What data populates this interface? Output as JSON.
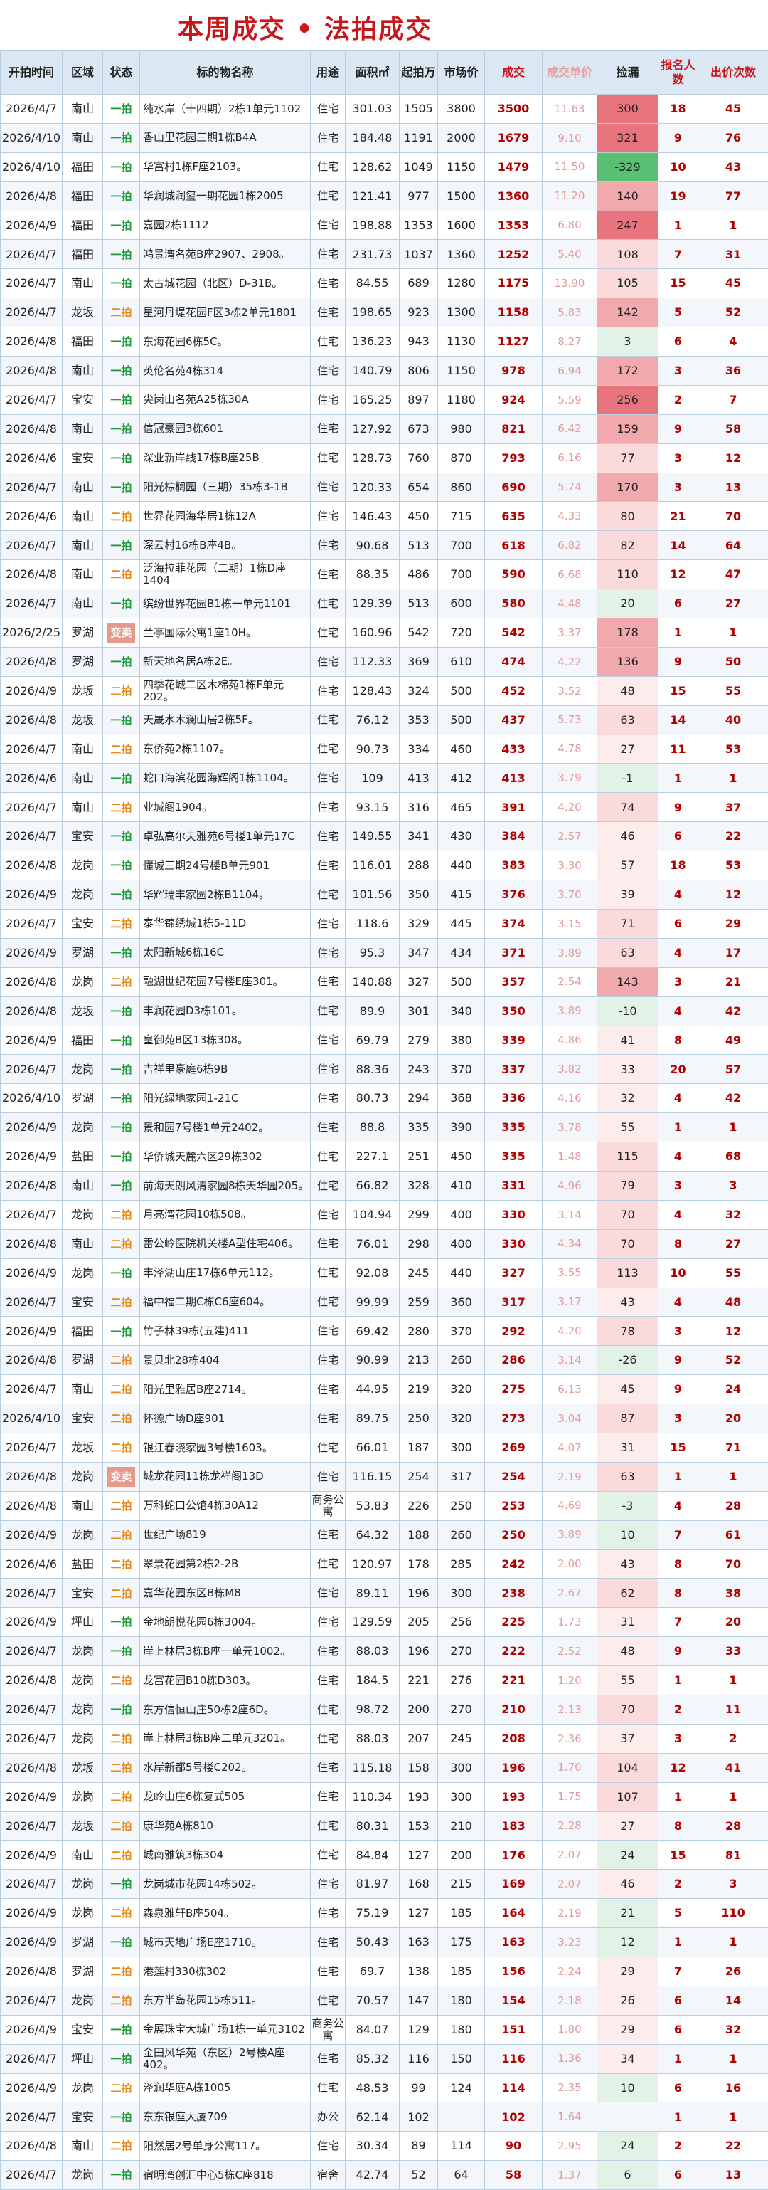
{
  "title": "本周成交 • 法拍成交",
  "headers": {
    "date": "开拍时间",
    "district": "区域",
    "status": "状态",
    "name": "标的物名称",
    "use": "用途",
    "area": "面积㎡",
    "start": "起拍万",
    "market": "市场价",
    "deal": "成交",
    "price": "成交单价",
    "gain": "捡漏",
    "bidders": "报名人数",
    "bids": "出价次数"
  },
  "rows": [
    [
      "2026/4/7",
      "南山",
      "一拍",
      "纯水岸（十四期）2栋1单元1102",
      "住宅",
      "301.03",
      "1505",
      "3800",
      "3500",
      "11.63",
      "300",
      "18",
      "45"
    ],
    [
      "2026/4/10",
      "南山",
      "一拍",
      "香山里花园三期1栋B4A",
      "住宅",
      "184.48",
      "1191",
      "2000",
      "1679",
      "9.10",
      "321",
      "9",
      "76"
    ],
    [
      "2026/4/10",
      "福田",
      "一拍",
      "华富村1栋F座2103。",
      "住宅",
      "128.62",
      "1049",
      "1150",
      "1479",
      "11.50",
      "-329",
      "10",
      "43"
    ],
    [
      "2026/4/8",
      "福田",
      "一拍",
      "华润城润玺一期花园1栋2005",
      "住宅",
      "121.41",
      "977",
      "1500",
      "1360",
      "11.20",
      "140",
      "19",
      "77"
    ],
    [
      "2026/4/9",
      "福田",
      "一拍",
      "嘉园2栋1112",
      "住宅",
      "198.88",
      "1353",
      "1600",
      "1353",
      "6.80",
      "247",
      "1",
      "1"
    ],
    [
      "2026/4/7",
      "福田",
      "一拍",
      "鸿景湾名苑B座2907、2908。",
      "住宅",
      "231.73",
      "1037",
      "1360",
      "1252",
      "5.40",
      "108",
      "7",
      "31"
    ],
    [
      "2026/4/7",
      "南山",
      "一拍",
      "太古城花园（北区）D-31B。",
      "住宅",
      "84.55",
      "689",
      "1280",
      "1175",
      "13.90",
      "105",
      "15",
      "45"
    ],
    [
      "2026/4/7",
      "龙坂",
      "二拍",
      "星河丹堤花园F区3栋2单元1801",
      "住宅",
      "198.65",
      "923",
      "1300",
      "1158",
      "5.83",
      "142",
      "5",
      "52"
    ],
    [
      "2026/4/8",
      "福田",
      "一拍",
      "东海花园6栋5C。",
      "住宅",
      "136.23",
      "943",
      "1130",
      "1127",
      "8.27",
      "3",
      "6",
      "4"
    ],
    [
      "2026/4/8",
      "南山",
      "一拍",
      "英伦名苑4栋314",
      "住宅",
      "140.79",
      "806",
      "1150",
      "978",
      "6.94",
      "172",
      "3",
      "36"
    ],
    [
      "2026/4/7",
      "宝安",
      "一拍",
      "尖岗山名苑A25栋30A",
      "住宅",
      "165.25",
      "897",
      "1180",
      "924",
      "5.59",
      "256",
      "2",
      "7"
    ],
    [
      "2026/4/8",
      "南山",
      "一拍",
      "信冠豪园3栋601",
      "住宅",
      "127.92",
      "673",
      "980",
      "821",
      "6.42",
      "159",
      "9",
      "58"
    ],
    [
      "2026/4/6",
      "宝安",
      "一拍",
      "深业新岸线17栋B座25B",
      "住宅",
      "128.73",
      "760",
      "870",
      "793",
      "6.16",
      "77",
      "3",
      "12"
    ],
    [
      "2026/4/7",
      "南山",
      "一拍",
      "阳光棕榈园（三期）35栋3-1B",
      "住宅",
      "120.33",
      "654",
      "860",
      "690",
      "5.74",
      "170",
      "3",
      "13"
    ],
    [
      "2026/4/6",
      "南山",
      "二拍",
      "世界花园海华居1栋12A",
      "住宅",
      "146.43",
      "450",
      "715",
      "635",
      "4.33",
      "80",
      "21",
      "70"
    ],
    [
      "2026/4/7",
      "南山",
      "一拍",
      "深云村16栋B座4B。",
      "住宅",
      "90.68",
      "513",
      "700",
      "618",
      "6.82",
      "82",
      "14",
      "64"
    ],
    [
      "2026/4/8",
      "南山",
      "二拍",
      "泛海拉菲花园（二期）1栋D座1404",
      "住宅",
      "88.35",
      "486",
      "700",
      "590",
      "6.68",
      "110",
      "12",
      "47"
    ],
    [
      "2026/4/7",
      "南山",
      "一拍",
      "缤纷世界花园B1栋一单元1101",
      "住宅",
      "129.39",
      "513",
      "600",
      "580",
      "4.48",
      "20",
      "6",
      "27"
    ],
    [
      "2026/2/25",
      "罗湖",
      "变卖",
      "兰亭国际公寓1座10H。",
      "住宅",
      "160.96",
      "542",
      "720",
      "542",
      "3.37",
      "178",
      "1",
      "1"
    ],
    [
      "2026/4/8",
      "罗湖",
      "一拍",
      "新天地名居A栋2E。",
      "住宅",
      "112.33",
      "369",
      "610",
      "474",
      "4.22",
      "136",
      "9",
      "50"
    ],
    [
      "2026/4/9",
      "龙坂",
      "二拍",
      "四季花城二区木棉苑1栋F单元202。",
      "住宅",
      "128.43",
      "324",
      "500",
      "452",
      "3.52",
      "48",
      "15",
      "55"
    ],
    [
      "2026/4/8",
      "龙坂",
      "一拍",
      "天晟水木澜山居2栋5F。",
      "住宅",
      "76.12",
      "353",
      "500",
      "437",
      "5.73",
      "63",
      "14",
      "40"
    ],
    [
      "2026/4/7",
      "南山",
      "二拍",
      "东侨苑2栋1107。",
      "住宅",
      "90.73",
      "334",
      "460",
      "433",
      "4.78",
      "27",
      "11",
      "53"
    ],
    [
      "2026/4/6",
      "南山",
      "一拍",
      "蛇口海滨花园海辉阁1栋1104。",
      "住宅",
      "109",
      "413",
      "412",
      "413",
      "3.79",
      "-1",
      "1",
      "1"
    ],
    [
      "2026/4/7",
      "南山",
      "二拍",
      "业城阁1904。",
      "住宅",
      "93.15",
      "316",
      "465",
      "391",
      "4.20",
      "74",
      "9",
      "37"
    ],
    [
      "2026/4/7",
      "宝安",
      "一拍",
      "卓弘高尔夫雅苑6号楼1单元17C",
      "住宅",
      "149.55",
      "341",
      "430",
      "384",
      "2.57",
      "46",
      "6",
      "22"
    ],
    [
      "2026/4/8",
      "龙岗",
      "一拍",
      "懂城三期24号楼B单元901",
      "住宅",
      "116.01",
      "288",
      "440",
      "383",
      "3.30",
      "57",
      "18",
      "53"
    ],
    [
      "2026/4/9",
      "龙岗",
      "一拍",
      "华辉瑞丰家园2栋B1104。",
      "住宅",
      "101.56",
      "350",
      "415",
      "376",
      "3.70",
      "39",
      "4",
      "12"
    ],
    [
      "2026/4/7",
      "宝安",
      "二拍",
      "泰华锦绣城1栋5-11D",
      "住宅",
      "118.6",
      "329",
      "445",
      "374",
      "3.15",
      "71",
      "6",
      "29"
    ],
    [
      "2026/4/9",
      "罗湖",
      "一拍",
      "太阳新城6栋16C",
      "住宅",
      "95.3",
      "347",
      "434",
      "371",
      "3.89",
      "63",
      "4",
      "17"
    ],
    [
      "2026/4/8",
      "龙岗",
      "二拍",
      "融湖世纪花园7号楼E座301。",
      "住宅",
      "140.88",
      "327",
      "500",
      "357",
      "2.54",
      "143",
      "3",
      "21"
    ],
    [
      "2026/4/8",
      "龙坂",
      "一拍",
      "丰润花园D3栋101。",
      "住宅",
      "89.9",
      "301",
      "340",
      "350",
      "3.89",
      "-10",
      "4",
      "42"
    ],
    [
      "2026/4/9",
      "福田",
      "一拍",
      "皇御苑B区13栋308。",
      "住宅",
      "69.79",
      "279",
      "380",
      "339",
      "4.86",
      "41",
      "8",
      "49"
    ],
    [
      "2026/4/7",
      "龙岗",
      "一拍",
      "吉祥里豪庭6栋9B",
      "住宅",
      "88.36",
      "243",
      "370",
      "337",
      "3.82",
      "33",
      "20",
      "57"
    ],
    [
      "2026/4/10",
      "罗湖",
      "一拍",
      "阳光绿地家园1-21C",
      "住宅",
      "80.73",
      "294",
      "368",
      "336",
      "4.16",
      "32",
      "4",
      "42"
    ],
    [
      "2026/4/9",
      "龙岗",
      "一拍",
      "景和园7号楼1单元2402。",
      "住宅",
      "88.8",
      "335",
      "390",
      "335",
      "3.78",
      "55",
      "1",
      "1"
    ],
    [
      "2026/4/9",
      "盐田",
      "一拍",
      "华侨城天麓六区29栋302",
      "住宅",
      "227.1",
      "251",
      "450",
      "335",
      "1.48",
      "115",
      "4",
      "68"
    ],
    [
      "2026/4/8",
      "南山",
      "一拍",
      "前海天朗风清家园8栋天华园205。",
      "住宅",
      "66.82",
      "328",
      "410",
      "331",
      "4.96",
      "79",
      "3",
      "3"
    ],
    [
      "2026/4/7",
      "龙岗",
      "二拍",
      "月亮湾花园10栋508。",
      "住宅",
      "104.94",
      "299",
      "400",
      "330",
      "3.14",
      "70",
      "4",
      "32"
    ],
    [
      "2026/4/8",
      "南山",
      "二拍",
      "雷公岭医院机关楼A型住宅406。",
      "住宅",
      "76.01",
      "298",
      "400",
      "330",
      "4.34",
      "70",
      "8",
      "27"
    ],
    [
      "2026/4/9",
      "龙岗",
      "一拍",
      "丰泽湖山庄17栋6单元112。",
      "住宅",
      "92.08",
      "245",
      "440",
      "327",
      "3.55",
      "113",
      "10",
      "55"
    ],
    [
      "2026/4/7",
      "宝安",
      "二拍",
      "福中福二期C栋C6座604。",
      "住宅",
      "99.99",
      "259",
      "360",
      "317",
      "3.17",
      "43",
      "4",
      "48"
    ],
    [
      "2026/4/9",
      "福田",
      "一拍",
      "竹子林39栋(五建)411",
      "住宅",
      "69.42",
      "280",
      "370",
      "292",
      "4.20",
      "78",
      "3",
      "12"
    ],
    [
      "2026/4/8",
      "罗湖",
      "二拍",
      "景贝北28栋404",
      "住宅",
      "90.99",
      "213",
      "260",
      "286",
      "3.14",
      "-26",
      "9",
      "52"
    ],
    [
      "2026/4/7",
      "南山",
      "二拍",
      "阳光里雅居B座2714。",
      "住宅",
      "44.95",
      "219",
      "320",
      "275",
      "6.13",
      "45",
      "9",
      "24"
    ],
    [
      "2026/4/10",
      "宝安",
      "二拍",
      "怀德广场D座901",
      "住宅",
      "89.75",
      "250",
      "320",
      "273",
      "3.04",
      "87",
      "3",
      "20"
    ],
    [
      "2026/4/7",
      "龙坂",
      "二拍",
      "银江春晓家园3号楼1603。",
      "住宅",
      "66.01",
      "187",
      "300",
      "269",
      "4.07",
      "31",
      "15",
      "71"
    ],
    [
      "2026/4/8",
      "龙岗",
      "变卖",
      "城龙花园11栋龙祥阁13D",
      "住宅",
      "116.15",
      "254",
      "317",
      "254",
      "2.19",
      "63",
      "1",
      "1"
    ],
    [
      "2026/4/8",
      "南山",
      "二拍",
      "万科蛇口公馆4栋30A12",
      "商务公寓",
      "53.83",
      "226",
      "250",
      "253",
      "4.69",
      "-3",
      "4",
      "28"
    ],
    [
      "2026/4/9",
      "龙岗",
      "二拍",
      "世纪广场819",
      "住宅",
      "64.32",
      "188",
      "260",
      "250",
      "3.89",
      "10",
      "7",
      "61"
    ],
    [
      "2026/4/6",
      "盐田",
      "二拍",
      "翠景花园第2栋2-2B",
      "住宅",
      "120.97",
      "178",
      "285",
      "242",
      "2.00",
      "43",
      "8",
      "70"
    ],
    [
      "2026/4/7",
      "宝安",
      "二拍",
      "嘉华花园东区B栋M8",
      "住宅",
      "89.11",
      "196",
      "300",
      "238",
      "2.67",
      "62",
      "8",
      "38"
    ],
    [
      "2026/4/9",
      "坪山",
      "一拍",
      "金地朗悦花园6栋3004。",
      "住宅",
      "129.59",
      "205",
      "256",
      "225",
      "1.73",
      "31",
      "7",
      "20"
    ],
    [
      "2026/4/7",
      "龙岗",
      "一拍",
      "岸上林居3栋B座一单元1002。",
      "住宅",
      "88.03",
      "196",
      "270",
      "222",
      "2.52",
      "48",
      "9",
      "33"
    ],
    [
      "2026/4/8",
      "龙岗",
      "二拍",
      "龙富花园B10栋D303。",
      "住宅",
      "184.5",
      "221",
      "276",
      "221",
      "1.20",
      "55",
      "1",
      "1"
    ],
    [
      "2026/4/7",
      "龙岗",
      "一拍",
      "东方信恒山庄50栋2座6D。",
      "住宅",
      "98.72",
      "200",
      "270",
      "210",
      "2.13",
      "70",
      "2",
      "11"
    ],
    [
      "2026/4/7",
      "龙岗",
      "二拍",
      "岸上林居3栋B座二单元3201。",
      "住宅",
      "88.03",
      "207",
      "245",
      "208",
      "2.36",
      "37",
      "3",
      "2"
    ],
    [
      "2026/4/8",
      "龙坂",
      "二拍",
      "水岸新都5号楼C202。",
      "住宅",
      "115.18",
      "158",
      "300",
      "196",
      "1.70",
      "104",
      "12",
      "41"
    ],
    [
      "2026/4/9",
      "龙岗",
      "二拍",
      "龙岭山庄6栋复式505",
      "住宅",
      "110.34",
      "193",
      "300",
      "193",
      "1.75",
      "107",
      "1",
      "1"
    ],
    [
      "2026/4/7",
      "龙坂",
      "二拍",
      "康华苑A栋810",
      "住宅",
      "80.31",
      "153",
      "210",
      "183",
      "2.28",
      "27",
      "8",
      "28"
    ],
    [
      "2026/4/9",
      "南山",
      "二拍",
      "城南雅筑3栋304",
      "住宅",
      "84.84",
      "127",
      "200",
      "176",
      "2.07",
      "24",
      "15",
      "81"
    ],
    [
      "2026/4/7",
      "龙岗",
      "一拍",
      "龙岗城市花园14栋502。",
      "住宅",
      "81.97",
      "168",
      "215",
      "169",
      "2.07",
      "46",
      "2",
      "3"
    ],
    [
      "2026/4/9",
      "龙岗",
      "二拍",
      "森泉雅轩B座504。",
      "住宅",
      "75.19",
      "127",
      "185",
      "164",
      "2.19",
      "21",
      "5",
      "110"
    ],
    [
      "2026/4/9",
      "罗湖",
      "一拍",
      "城市天地广场E座1710。",
      "住宅",
      "50.43",
      "163",
      "175",
      "163",
      "3.23",
      "12",
      "1",
      "1"
    ],
    [
      "2026/4/8",
      "罗湖",
      "二拍",
      "港莲村330栋302",
      "住宅",
      "69.7",
      "138",
      "185",
      "156",
      "2.24",
      "29",
      "7",
      "26"
    ],
    [
      "2026/4/7",
      "龙岗",
      "二拍",
      "东方半岛花园15栋511。",
      "住宅",
      "70.57",
      "147",
      "180",
      "154",
      "2.18",
      "26",
      "6",
      "14"
    ],
    [
      "2026/4/9",
      "宝安",
      "一拍",
      "金展珠宝大城广场1栋一单元3102",
      "商务公寓",
      "84.07",
      "129",
      "180",
      "151",
      "1.80",
      "29",
      "6",
      "32"
    ],
    [
      "2026/4/7",
      "坪山",
      "一拍",
      "金田风华苑（东区）2号楼A座402。",
      "住宅",
      "85.32",
      "116",
      "150",
      "116",
      "1.36",
      "34",
      "1",
      "1"
    ],
    [
      "2026/4/9",
      "龙岗",
      "二拍",
      "泽润华庭A栋1005",
      "住宅",
      "48.53",
      "99",
      "124",
      "114",
      "2.35",
      "10",
      "6",
      "16"
    ],
    [
      "2026/4/7",
      "宝安",
      "一拍",
      "东东银座大厦709",
      "办公",
      "62.14",
      "102",
      "",
      "102",
      "1.64",
      "",
      "1",
      "1"
    ],
    [
      "2026/4/8",
      "南山",
      "二拍",
      "阳然居2号单身公寓117。",
      "住宅",
      "30.34",
      "89",
      "114",
      "90",
      "2.95",
      "24",
      "2",
      "22"
    ],
    [
      "2026/4/7",
      "龙岗",
      "一拍",
      "宿明湾创汇中心5栋C座818",
      "宿舍",
      "42.74",
      "52",
      "64",
      "58",
      "1.37",
      "6",
      "6",
      "13"
    ]
  ],
  "colors": {
    "title": "#c8161d",
    "header_bg": "#dbe8f3",
    "grid": "#b9cfe0",
    "deal": "#b00000",
    "price": "#e29a9a",
    "first_auction": "#1e9a3b",
    "second_auction": "#e88a1a",
    "sale_badge": "#e69a8c",
    "gain_strong": "#e8747e",
    "gain_mid": "#f2a9ae",
    "gain_light": "#fbdadc",
    "gain_faint": "#fdecec",
    "gain_negative": "#5bbf73",
    "gain_neg_light": "#e3f2e6"
  }
}
